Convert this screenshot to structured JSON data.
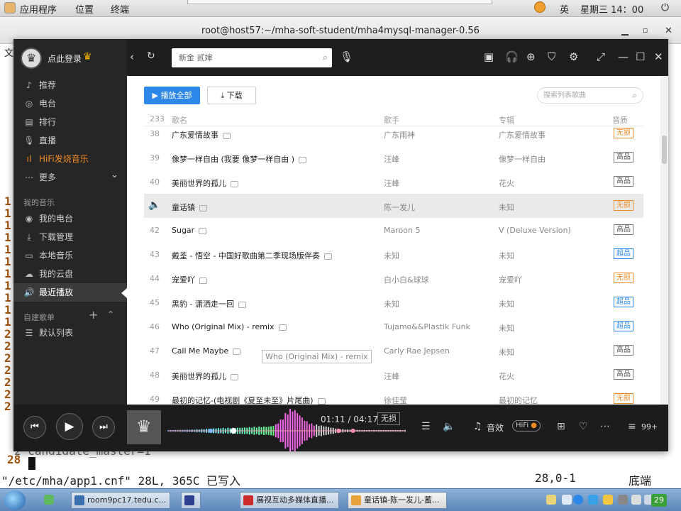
{
  "top_panel": {
    "applications": "应用程序",
    "places": "位置",
    "terminal": "终端",
    "input_method": "英",
    "datetime": "星期三 14：00"
  },
  "terminal": {
    "title": "root@host57:~/mha-soft-student/mha4mysql-manager-0.56",
    "menu_fragment": "文",
    "line_numbers": [
      "1",
      "1",
      "1",
      "1",
      "1",
      "1",
      "1",
      "1",
      "1",
      "1",
      "1",
      "2",
      "2",
      "2",
      "2",
      "2",
      "2",
      "2"
    ],
    "partial_line": "2  candidate_master=1",
    "last_line": "28",
    "status_file": "\"/etc/mha/app1.cnf\" 28L, 365C 已写入",
    "status_pos": "28,0-1",
    "status_where": "底端"
  },
  "player": {
    "login_label": "点此登录",
    "nav": [
      {
        "icon": "recommend-icon",
        "glyph": "♪",
        "label": "推荐"
      },
      {
        "icon": "radio-icon",
        "glyph": "◎",
        "label": "电台"
      },
      {
        "icon": "ranking-icon",
        "glyph": "▤",
        "label": "排行"
      },
      {
        "icon": "live-icon",
        "glyph": "🎙",
        "label": "直播"
      },
      {
        "icon": "hifi-icon",
        "glyph": "ıl",
        "label": "HiFi发烧音乐"
      },
      {
        "icon": "more-icon",
        "glyph": "⋯",
        "label": "更多"
      }
    ],
    "my_music_label": "我的音乐",
    "my_music": [
      {
        "icon": "my-radio-icon",
        "glyph": "◉",
        "label": "我的电台"
      },
      {
        "icon": "download-manage-icon",
        "glyph": "⤓",
        "label": "下载管理"
      },
      {
        "icon": "local-music-icon",
        "glyph": "▭",
        "label": "本地音乐"
      },
      {
        "icon": "cloud-icon",
        "glyph": "☁",
        "label": "我的云盘"
      },
      {
        "icon": "recent-play-icon",
        "glyph": "🔊",
        "label": "最近播放"
      }
    ],
    "playlists_label": "自建歌单",
    "playlists": [
      {
        "icon": "list-icon",
        "glyph": "☰",
        "label": "默认列表"
      }
    ],
    "search": {
      "value": "新金 贰婶"
    },
    "toolbar": {
      "play_all": "播放全部",
      "download": "下载",
      "list_search_placeholder": "搜索列表歌曲"
    },
    "columns": {
      "count": "233",
      "song": "歌名",
      "artist": "歌手",
      "album": "专辑",
      "quality": "音质"
    },
    "songs": [
      {
        "num": "38",
        "title": "广东爱情故事",
        "artist": "广东雨神",
        "album": "广东爱情故事",
        "quality": "无损",
        "qtype": "lossless"
      },
      {
        "num": "39",
        "title": "像梦一样自由 (我要 像梦一样自由 )",
        "artist": "汪峰",
        "album": "像梦一样自由",
        "quality": "高品",
        "qtype": "hq"
      },
      {
        "num": "40",
        "title": "美丽世界的孤儿",
        "artist": "汪峰",
        "album": "花火",
        "quality": "高品",
        "qtype": "hq"
      },
      {
        "num": "",
        "title": "童话镇",
        "artist": "陈一发儿",
        "album": "未知",
        "quality": "无损",
        "qtype": "lossless"
      },
      {
        "num": "42",
        "title": "Sugar",
        "artist": "Maroon 5",
        "album": "V (Deluxe Version)",
        "quality": "高品",
        "qtype": "hq"
      },
      {
        "num": "43",
        "title": "戴荃 - 悟空 - 中国好歌曲第二季现场版伴奏",
        "artist": "未知",
        "album": "未知",
        "quality": "超品",
        "qtype": "sq"
      },
      {
        "num": "44",
        "title": "宠爱吖",
        "artist": "白小白&球球",
        "album": "宠爱吖",
        "quality": "无损",
        "qtype": "lossless"
      },
      {
        "num": "45",
        "title": "黑豹 - 潇洒走一回",
        "artist": "未知",
        "album": "未知",
        "quality": "超品",
        "qtype": "sq"
      },
      {
        "num": "46",
        "title": "Who (Original Mix) - remix",
        "artist": "Tujamo&&Plastik Funk",
        "album": "未知",
        "quality": "超品",
        "qtype": "sq"
      },
      {
        "num": "47",
        "title": "Call Me Maybe",
        "artist": "Carly Rae Jepsen",
        "album": "未知",
        "quality": "高品",
        "qtype": "hq"
      },
      {
        "num": "48",
        "title": "美丽世界的孤儿",
        "artist": "汪峰",
        "album": "花火",
        "quality": "高品",
        "qtype": "hq"
      },
      {
        "num": "49",
        "title": "最初的记忆-(电视剧《夏至未至》片尾曲)",
        "artist": "徐佳莹",
        "album": "最初的记忆",
        "quality": "无损",
        "qtype": "lossless"
      }
    ],
    "tooltip": "Who (Original Mix) - remix",
    "playback": {
      "time": "01:11 / 04:17",
      "quality": "无损",
      "effect": "音效",
      "hifi": "HiFi",
      "queue_count": "99+",
      "progress": 0.276
    }
  },
  "taskbar": {
    "apps": [
      {
        "icon_color": "#3a6fb0",
        "label": "room9pc17.tedu.c..."
      },
      {
        "icon_color": "#2f3f8f",
        "label": ""
      },
      {
        "icon_color": "#cc2b2b",
        "label": "展视互动多媒体直播..."
      },
      {
        "icon_color": "#e8a23a",
        "label": "童话镇-陈一发儿-蓄..."
      }
    ],
    "badge": "29"
  },
  "colors": {
    "accent": "#2d87e8",
    "lossless": "#f08a24",
    "hq": "#7a7a7a",
    "sq": "#2d87e8",
    "terminal_ln": "#a0520c"
  }
}
